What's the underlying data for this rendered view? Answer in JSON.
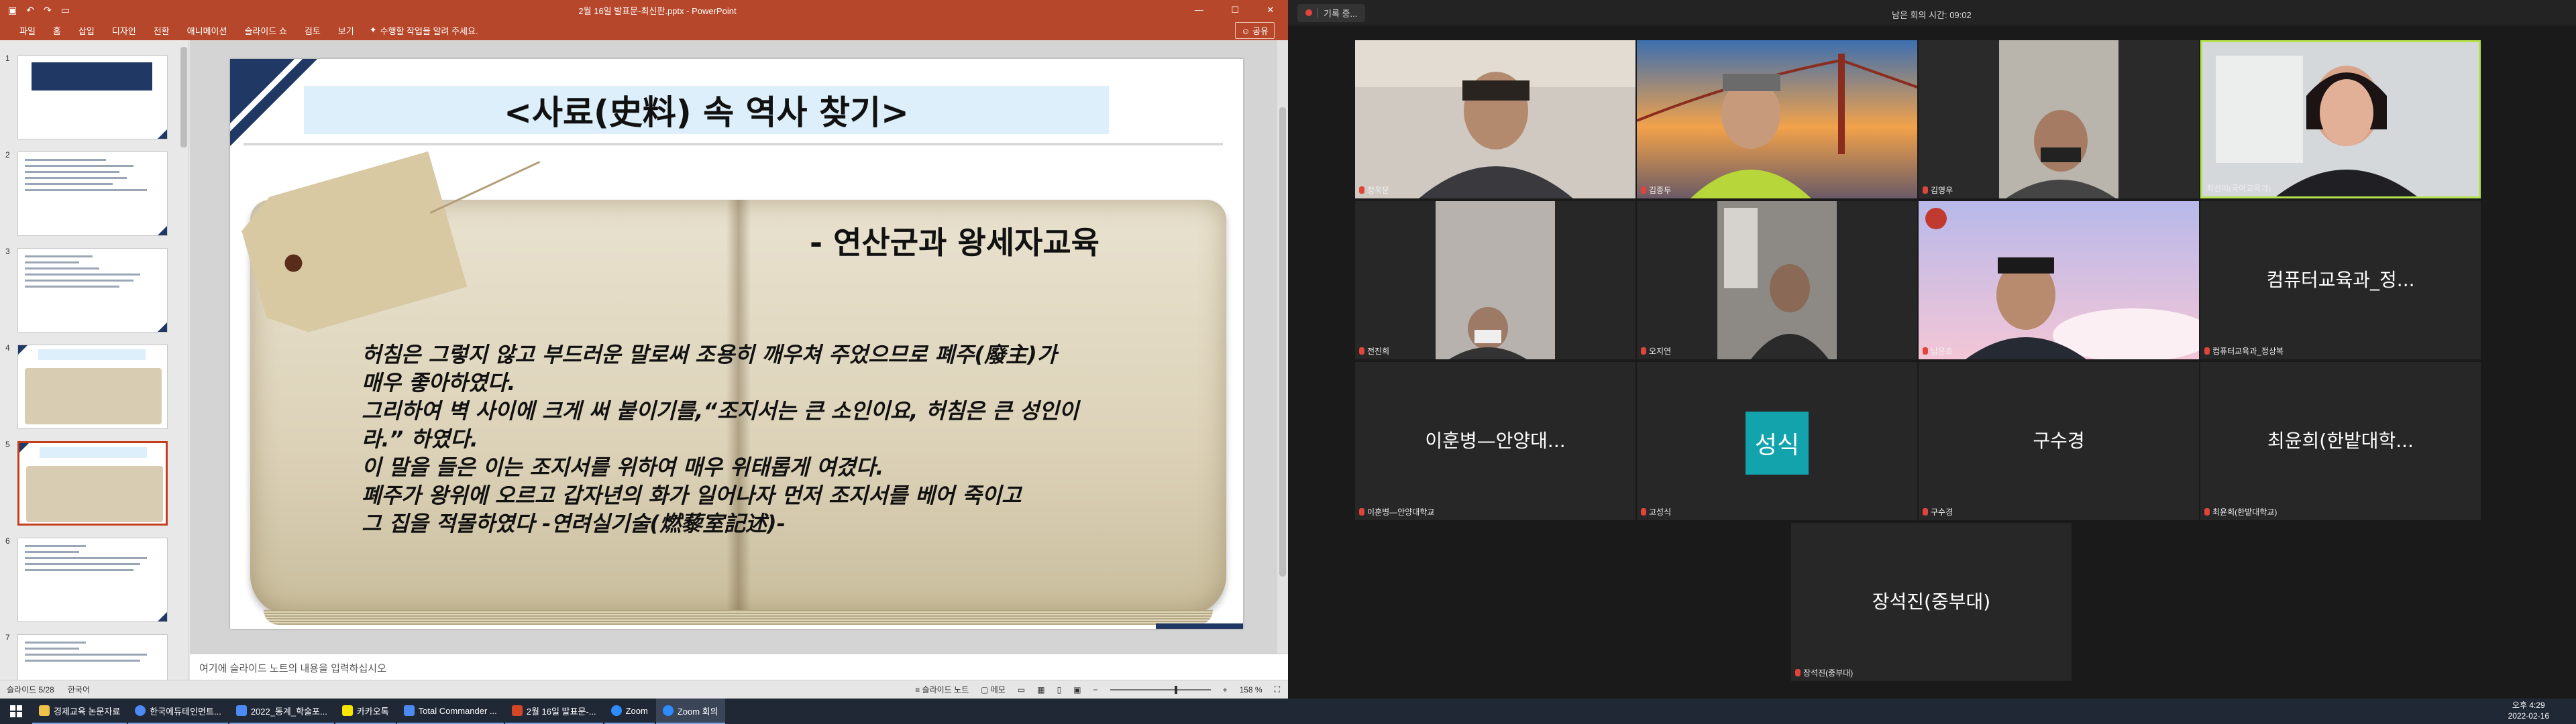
{
  "powerpoint": {
    "qat_icons": [
      "save-icon",
      "undo-icon",
      "redo-icon",
      "present-icon"
    ],
    "doc_title": "2월 16일 발표문-최신판.pptx - PowerPoint",
    "ribbon_tabs": [
      "파일",
      "홈",
      "삽입",
      "디자인",
      "전환",
      "애니메이션",
      "슬라이드 쇼",
      "검토",
      "보기"
    ],
    "tell_me": "수행할 작업을 알려 주세요.",
    "share": "공유",
    "thumbnails": [
      {
        "num": "1",
        "kind": "title"
      },
      {
        "num": "2",
        "kind": "text"
      },
      {
        "num": "3",
        "kind": "text"
      },
      {
        "num": "4",
        "kind": "book"
      },
      {
        "num": "5",
        "kind": "book",
        "selected": true
      },
      {
        "num": "6",
        "kind": "text"
      },
      {
        "num": "7",
        "kind": "text"
      }
    ],
    "slide": {
      "title": "<사료(史料) 속 역사 찾기>",
      "subtitle": "- 연산군과 왕세자교육",
      "body_lines": [
        "허침은 그렇지 않고 부드러운 말로써 조용히 깨우쳐 주었으므로 폐주(廢主)가",
        "매우 좋아하였다.",
        " 그리하여 벽 사이에 크게 써 붙이기를,“조지서는 큰 소인이요, 허침은 큰 성인이",
        "라.” 하였다.",
        "이 말을 들은 이는 조지서를 위하여 매우 위태롭게 여겼다.",
        "폐주가 왕위에 오르고 갑자년의 화가 일어나자 먼저 조지서를 베어 죽이고",
        "그 집을 적몰하였다 -연려실기술(燃藜室記述)-"
      ]
    },
    "notes_placeholder": "여기에 슬라이드 노트의 내용을 입력하십시오",
    "status": {
      "slide_count": "슬라이드 5/28",
      "language": "한국어",
      "notes_btn": "슬라이드 노트",
      "comments_btn": "메모",
      "zoom": "158 %"
    }
  },
  "zoom": {
    "recording": "기록 중...",
    "meeting_time": "남은 회의 시간: 09:02",
    "participants": [
      {
        "label": "정욱문",
        "type": "video"
      },
      {
        "label": "김종두",
        "type": "video"
      },
      {
        "label": "김영우",
        "type": "video"
      },
      {
        "label": "최선미(국어교육과)",
        "type": "video",
        "active": true
      },
      {
        "label": "전진희",
        "type": "video"
      },
      {
        "label": "오지연",
        "type": "video"
      },
      {
        "label": "남윤호",
        "type": "video"
      },
      {
        "label": "컴퓨터교육과_정상복",
        "type": "name",
        "display": "컴퓨터교육과_정..."
      },
      {
        "label": "이훈병—안양대학교",
        "type": "name",
        "display": "이훈병—안양대..."
      },
      {
        "label": "고성식",
        "type": "avatar",
        "display": "성식"
      },
      {
        "label": "구수경",
        "type": "name",
        "display": "구수경"
      },
      {
        "label": "최윤희(한밭대학교)",
        "type": "name",
        "display": "최윤희(한밭대학..."
      },
      {
        "label": "장석진(중부대)",
        "type": "name",
        "display": "장석진(중부대)"
      }
    ]
  },
  "taskbar": {
    "apps": [
      {
        "label": "경제교육 논문자료",
        "icon": "folder-icon",
        "color": "#f0c24b"
      },
      {
        "label": "한국에듀테인먼트...",
        "icon": "chrome-icon",
        "color": "#4c8bf5"
      },
      {
        "label": "2022_동계_학술포...",
        "icon": "document-icon",
        "color": "#4c8bf5"
      },
      {
        "label": "카카오톡",
        "icon": "kakaotalk-icon",
        "color": "#f7e600"
      },
      {
        "label": "Total Commander ...",
        "icon": "disk-icon",
        "color": "#4c8bf5"
      },
      {
        "label": "2월 16일 발표문-...",
        "icon": "powerpoint-icon",
        "color": "#d24726"
      },
      {
        "label": "Zoom",
        "icon": "zoom-icon",
        "color": "#2d8cff"
      },
      {
        "label": "Zoom 회의",
        "icon": "zoom-icon",
        "color": "#2d8cff",
        "active": true
      }
    ],
    "time": "오후 4:29",
    "date": "2022-02-16"
  }
}
